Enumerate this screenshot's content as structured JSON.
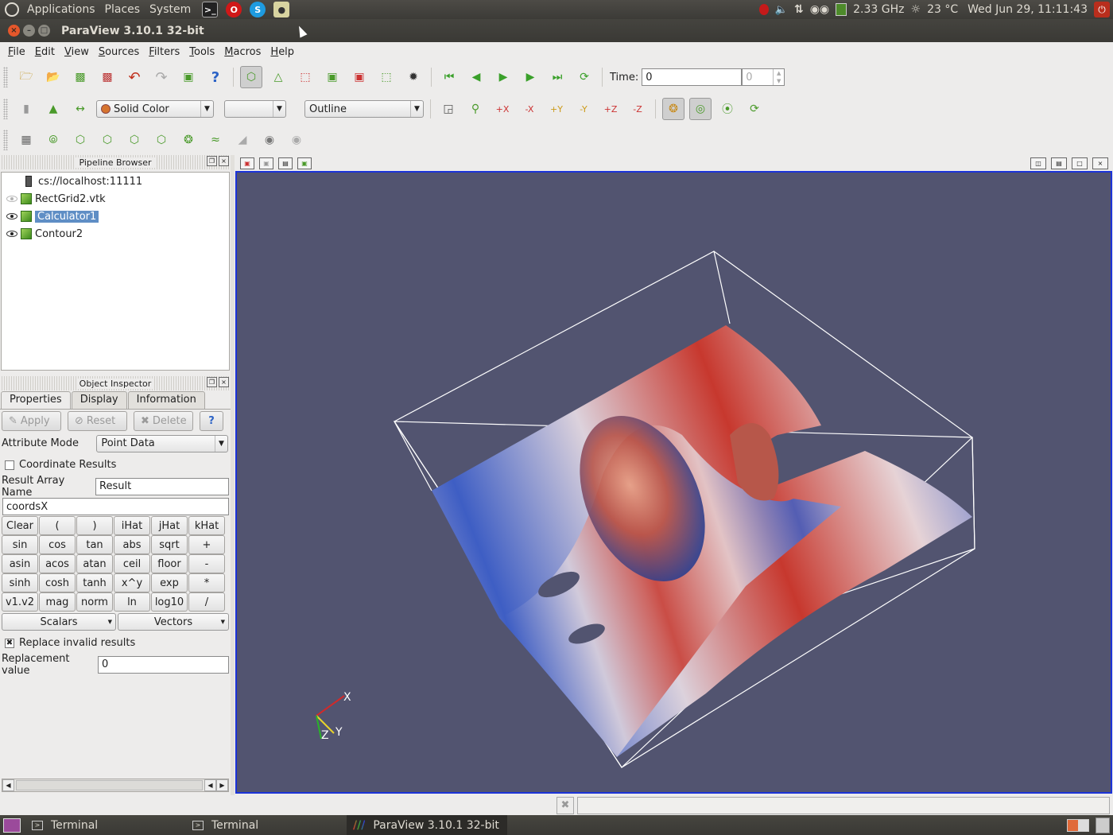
{
  "topbar": {
    "menus": [
      "Applications",
      "Places",
      "System"
    ],
    "cpu_freq": "2.33 GHz",
    "temperature": "23 °C",
    "datetime": "Wed Jun 29, 11:11:43"
  },
  "window": {
    "title": "ParaView 3.10.1 32-bit"
  },
  "menubar": {
    "items": [
      {
        "label": "File",
        "mnemonic": "F",
        "rest": "ile"
      },
      {
        "label": "Edit",
        "mnemonic": "E",
        "rest": "dit"
      },
      {
        "label": "View",
        "mnemonic": "V",
        "rest": "iew"
      },
      {
        "label": "Sources",
        "mnemonic": "S",
        "rest": "ources"
      },
      {
        "label": "Filters",
        "mnemonic": "F",
        "rest": "ilters"
      },
      {
        "label": "Tools",
        "mnemonic": "T",
        "rest": "ools"
      },
      {
        "label": "Macros",
        "mnemonic": "M",
        "rest": "acros"
      },
      {
        "label": "Help",
        "mnemonic": "H",
        "rest": "elp"
      }
    ]
  },
  "toolbar": {
    "time_label": "Time:",
    "time_value": "0",
    "time_step": "0",
    "color_by": "Solid Color",
    "component": "",
    "representation": "Outline"
  },
  "pipeline": {
    "title": "Pipeline Browser",
    "server": "cs://localhost:11111",
    "items": [
      {
        "name": "RectGrid2.vtk",
        "visible": false,
        "selected": false
      },
      {
        "name": "Calculator1",
        "visible": true,
        "selected": true
      },
      {
        "name": "Contour2",
        "visible": true,
        "selected": false
      }
    ]
  },
  "inspector": {
    "title": "Object Inspector",
    "tabs": [
      "Properties",
      "Display",
      "Information"
    ],
    "buttons": {
      "apply": "Apply",
      "reset": "Reset",
      "delete": "Delete",
      "help": "?"
    },
    "attribute_mode_label": "Attribute Mode",
    "attribute_mode_value": "Point Data",
    "coordinate_results_label": "Coordinate Results",
    "coordinate_results_checked": false,
    "result_array_label": "Result Array Name",
    "result_array_value": "Result",
    "expression": "coordsX",
    "calc_rows": [
      [
        "Clear",
        "(",
        ")",
        "iHat",
        "jHat",
        "kHat"
      ],
      [
        "sin",
        "cos",
        "tan",
        "abs",
        "sqrt",
        "+"
      ],
      [
        "asin",
        "acos",
        "atan",
        "ceil",
        "floor",
        "-"
      ],
      [
        "sinh",
        "cosh",
        "tanh",
        "x^y",
        "exp",
        "*"
      ],
      [
        "v1.v2",
        "mag",
        "norm",
        "ln",
        "log10",
        "/"
      ]
    ],
    "scalars_label": "Scalars",
    "vectors_label": "Vectors",
    "replace_invalid_label": "Replace invalid results",
    "replace_invalid_checked": true,
    "replacement_label": "Replacement value",
    "replacement_value": "0"
  },
  "view": {
    "background": "#525470",
    "axes": {
      "x": "X",
      "y": "Y",
      "z": "Z"
    }
  },
  "taskbar": {
    "tasks": [
      "Terminal",
      "Terminal",
      "ParaView 3.10.1 32-bit"
    ]
  }
}
